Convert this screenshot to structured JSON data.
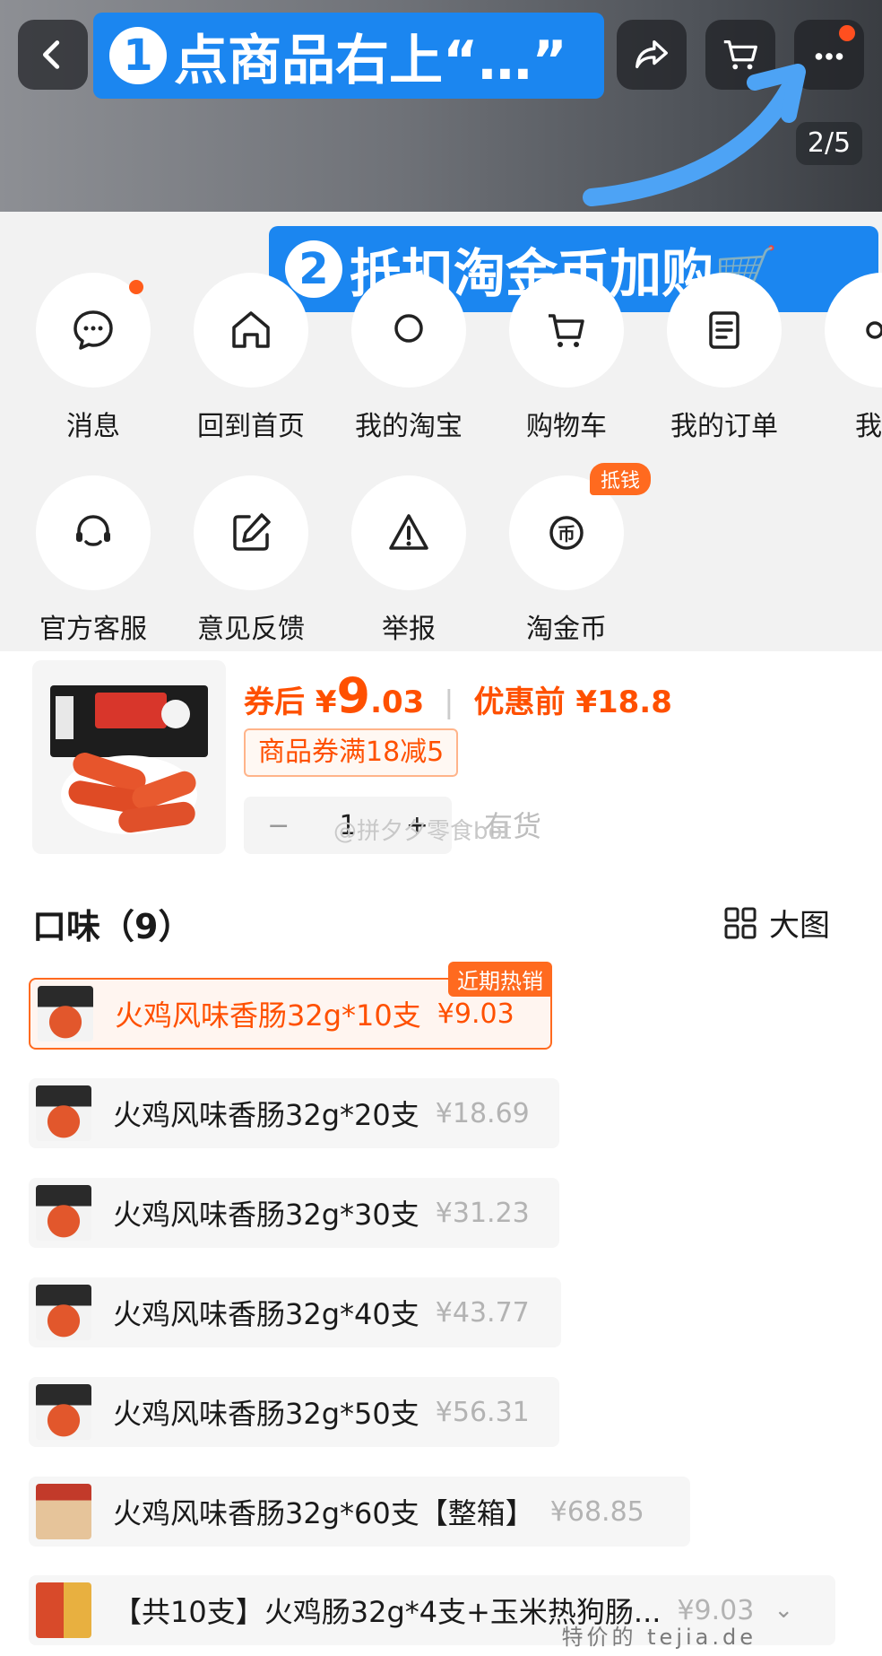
{
  "header": {
    "page_indicator": "2/5",
    "icons": [
      "back-icon",
      "share-icon",
      "cart-icon",
      "more-icon"
    ]
  },
  "steps": [
    {
      "num": "1",
      "text": "点商品右上“…”"
    },
    {
      "num": "2",
      "text": "抵扣淘金币加购🛒"
    }
  ],
  "menu": {
    "items": [
      {
        "label": "消息",
        "icon": "message-icon"
      },
      {
        "label": "回到首页",
        "icon": "home-icon"
      },
      {
        "label": "我的淘宝",
        "icon": "profile-icon"
      },
      {
        "label": "购物车",
        "icon": "cart-icon"
      },
      {
        "label": "我的订单",
        "icon": "order-icon"
      },
      {
        "label": "我的",
        "icon": "more-icon"
      },
      {
        "label": "官方客服",
        "icon": "support-icon"
      },
      {
        "label": "意见反馈",
        "icon": "feedback-icon"
      },
      {
        "label": "举报",
        "icon": "report-icon"
      },
      {
        "label": "淘金币",
        "icon": "coin-icon",
        "badge": "抵钱"
      }
    ]
  },
  "product": {
    "after_coupon_label": "券后",
    "currency": "¥",
    "after_coupon_int": "9",
    "after_coupon_dec": ".03",
    "before_label": "优惠前",
    "before_price": "¥18.8",
    "coupon": "商品券满18减5",
    "quantity": "1",
    "minus": "−",
    "plus": "+",
    "stock": "有货",
    "watermark": "@拼夕夕零食bot"
  },
  "flavors": {
    "title": "口味（9）",
    "bigview_label": "大图",
    "hot_tag": "近期热销",
    "items": [
      {
        "name": "火鸡风味香肠32g*10支",
        "price": "¥9.03",
        "selected": true
      },
      {
        "name": "火鸡风味香肠32g*20支",
        "price": "¥18.69"
      },
      {
        "name": "火鸡风味香肠32g*30支",
        "price": "¥31.23"
      },
      {
        "name": "火鸡风味香肠32g*40支",
        "price": "¥43.77"
      },
      {
        "name": "火鸡风味香肠32g*50支",
        "price": "¥56.31"
      },
      {
        "name": "火鸡风味香肠32g*60支【整箱】",
        "price": "¥68.85"
      },
      {
        "name": "【共10支】火鸡肠32g*4支+玉米热狗肠...",
        "price": "¥9.03"
      }
    ]
  },
  "footer_watermark": "特价的 tejia.de",
  "colors": {
    "accent": "#ff5000",
    "step_blue": "#1b86f0"
  }
}
